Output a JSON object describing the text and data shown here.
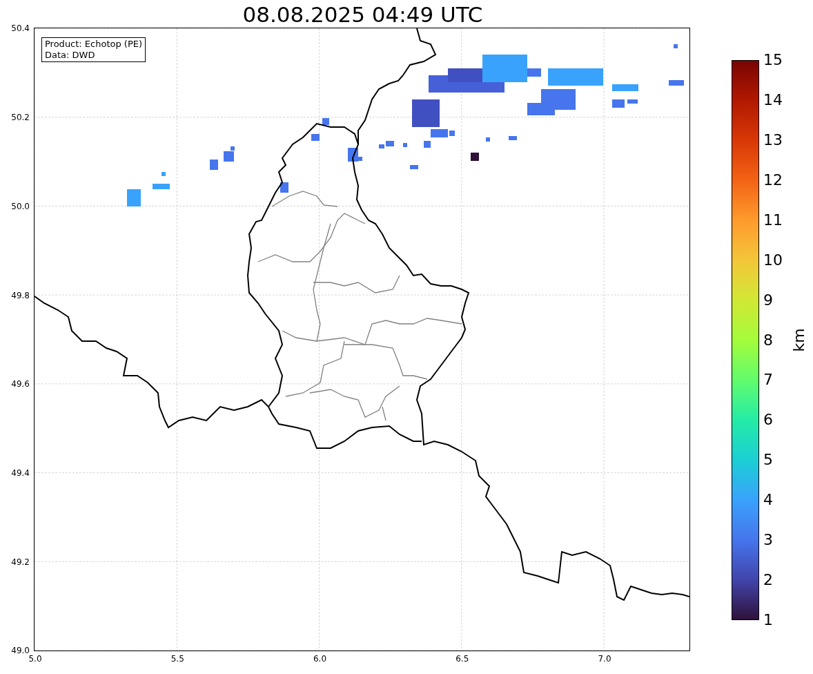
{
  "title": "08.08.2025 04:49 UTC",
  "info_box": {
    "lines": [
      "Product: Echotop (PE)",
      "Data: DWD"
    ]
  },
  "y_axis": {
    "ticks": [
      "50.4",
      "50.2",
      "50.0",
      "49.8",
      "49.6",
      "49.4",
      "49.2",
      "49.0"
    ]
  },
  "x_axis": {
    "ticks": [
      "5.0",
      "5.5",
      "6.0",
      "6.5",
      "7.0"
    ]
  },
  "colorbar": {
    "label": "km",
    "ticks": [
      "15",
      "14",
      "13",
      "12",
      "11",
      "10",
      "9",
      "8",
      "7",
      "6",
      "5",
      "4",
      "3",
      "2",
      "1"
    ]
  }
}
